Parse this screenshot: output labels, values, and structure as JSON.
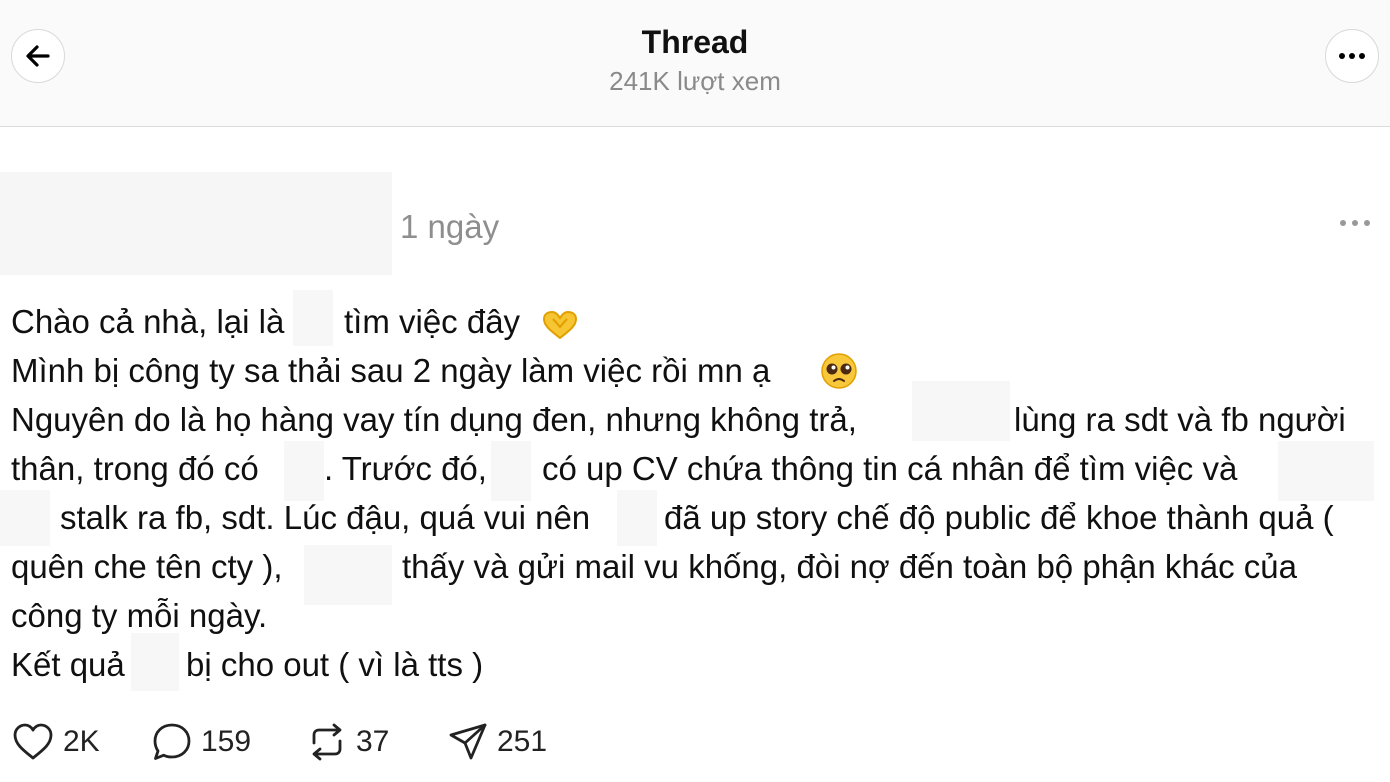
{
  "header": {
    "title": "Thread",
    "views": "241K lượt xem"
  },
  "post": {
    "time": "1 ngày",
    "lines": [
      {
        "a": "Chào cả nhà, lại là",
        "b": "tìm việc đây"
      },
      {
        "a": "Mình bị công ty sa thải sau 2 ngày làm việc rồi mn ạ"
      },
      {
        "a": "Nguyên do là họ hàng vay tín dụng đen, nhưng không trả,",
        "b": "lùng ra sdt và fb người"
      },
      {
        "a": "thân, trong đó có",
        "b": ". Trước đó,",
        "c": "có up CV chứa thông tin cá nhân để tìm việc và"
      },
      {
        "a": "stalk ra fb, sdt. Lúc đậu, quá vui nên",
        "b": "đã up story chế độ public để khoe thành quả ("
      },
      {
        "a": "quên che tên cty ),",
        "b": "thấy và gửi mail vu khống, đòi nợ đến toàn bộ phận khác của"
      },
      {
        "a": "công ty mỗi ngày."
      },
      {
        "a": "Kết quả",
        "b": "bị cho out ( vì là tts )"
      }
    ]
  },
  "actions": {
    "likes": "2K",
    "replies": "159",
    "reposts": "37",
    "shares": "251"
  },
  "icons": [
    "back-arrow-icon",
    "more-icon",
    "heart-icon",
    "comment-icon",
    "repost-icon",
    "share-icon",
    "heart-hands-emoji",
    "pleading-face-emoji"
  ]
}
